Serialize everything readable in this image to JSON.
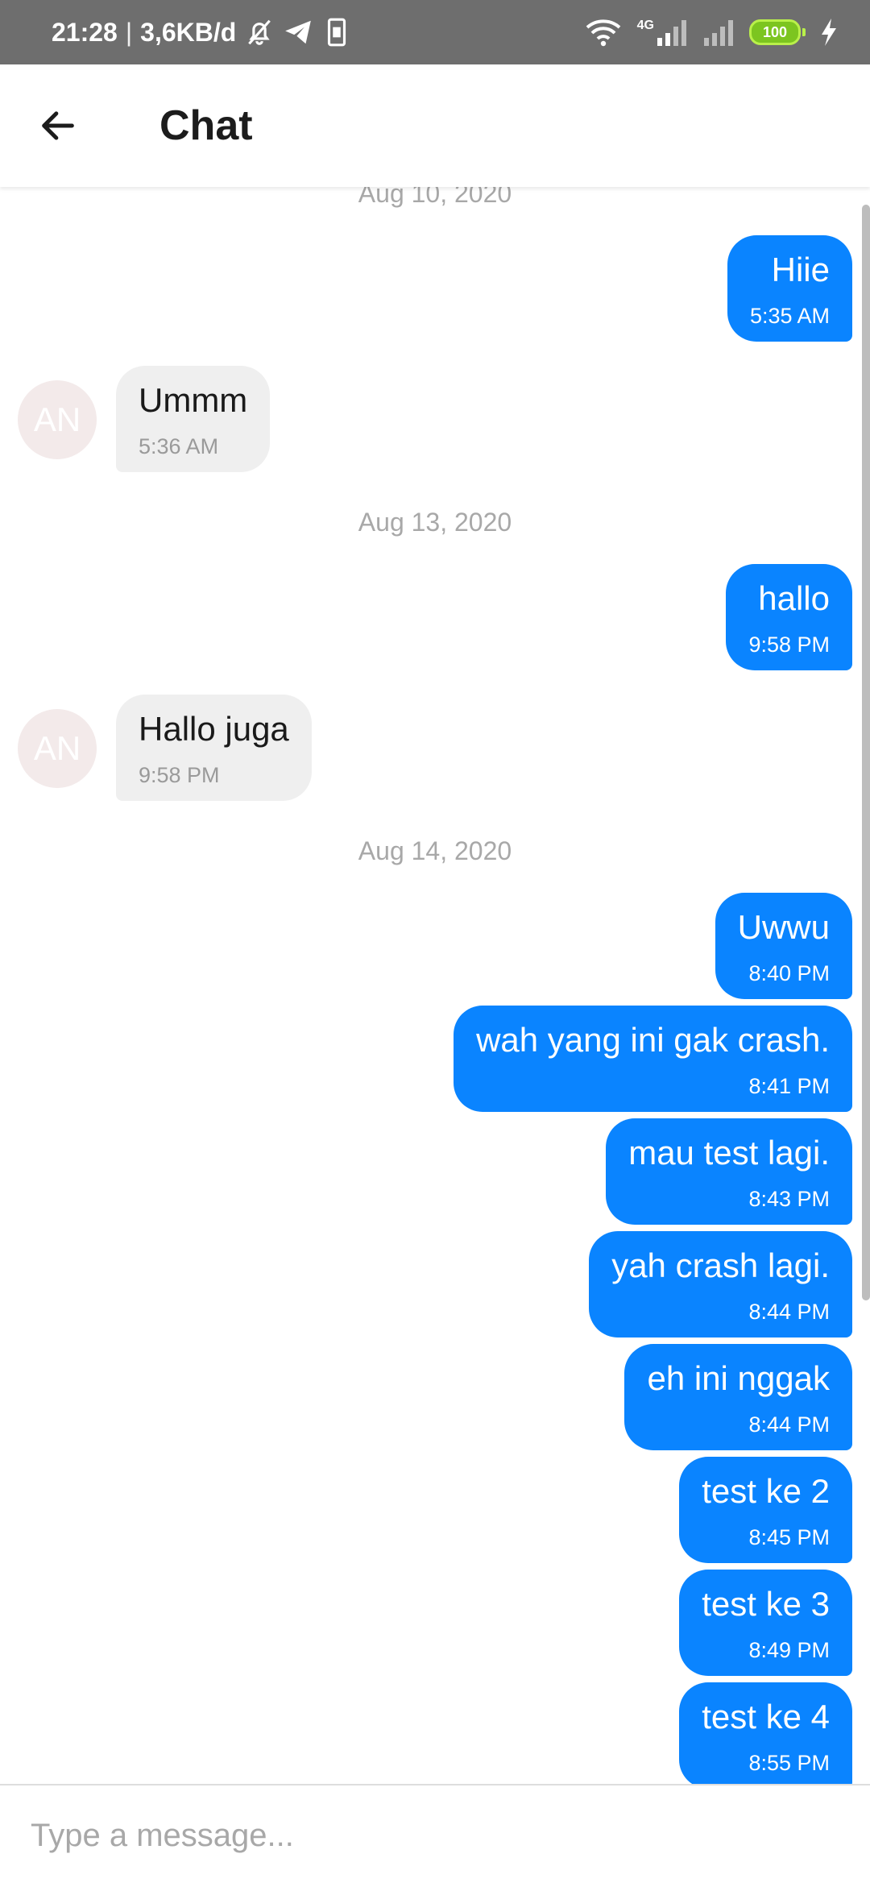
{
  "status_bar": {
    "time": "21:28",
    "separator": "|",
    "network_speed": "3,6KB/d",
    "network_type": "4G",
    "battery": "100",
    "icons": [
      "bell-off-icon",
      "telegram-icon",
      "sim-icon",
      "wifi-icon",
      "signal-icon",
      "signal-icon",
      "charging-icon"
    ]
  },
  "app_bar": {
    "back_icon": "arrow-left-icon",
    "title": "Chat"
  },
  "contact": {
    "avatar_initials": "AN"
  },
  "colors": {
    "outgoing_bubble": "#0a84ff",
    "incoming_bubble": "#efefef",
    "status_bar": "#6e6e6e"
  },
  "conversation": [
    {
      "type": "date",
      "label": "Aug 10, 2020"
    },
    {
      "type": "message",
      "direction": "out",
      "text": "Hiie",
      "time": "5:35 AM"
    },
    {
      "type": "message",
      "direction": "in",
      "text": "Ummm",
      "time": "5:36 AM"
    },
    {
      "type": "date",
      "label": "Aug 13, 2020"
    },
    {
      "type": "message",
      "direction": "out",
      "text": "hallo",
      "time": "9:58 PM"
    },
    {
      "type": "message",
      "direction": "in",
      "text": "Hallo juga",
      "time": "9:58 PM"
    },
    {
      "type": "date",
      "label": "Aug 14, 2020"
    },
    {
      "type": "message",
      "direction": "out",
      "text": "Uwwu",
      "time": "8:40 PM"
    },
    {
      "type": "message",
      "direction": "out",
      "text": "wah yang ini gak crash.",
      "time": "8:41 PM"
    },
    {
      "type": "message",
      "direction": "out",
      "text": "mau test lagi.",
      "time": "8:43 PM"
    },
    {
      "type": "message",
      "direction": "out",
      "text": "yah crash lagi.",
      "time": "8:44 PM"
    },
    {
      "type": "message",
      "direction": "out",
      "text": "eh ini nggak",
      "time": "8:44 PM"
    },
    {
      "type": "message",
      "direction": "out",
      "text": "test ke 2",
      "time": "8:45 PM"
    },
    {
      "type": "message",
      "direction": "out",
      "text": "test ke 3",
      "time": "8:49 PM"
    },
    {
      "type": "message",
      "direction": "out",
      "text": "test ke 4",
      "time": "8:55 PM"
    }
  ],
  "composer": {
    "placeholder": "Type a message..."
  }
}
